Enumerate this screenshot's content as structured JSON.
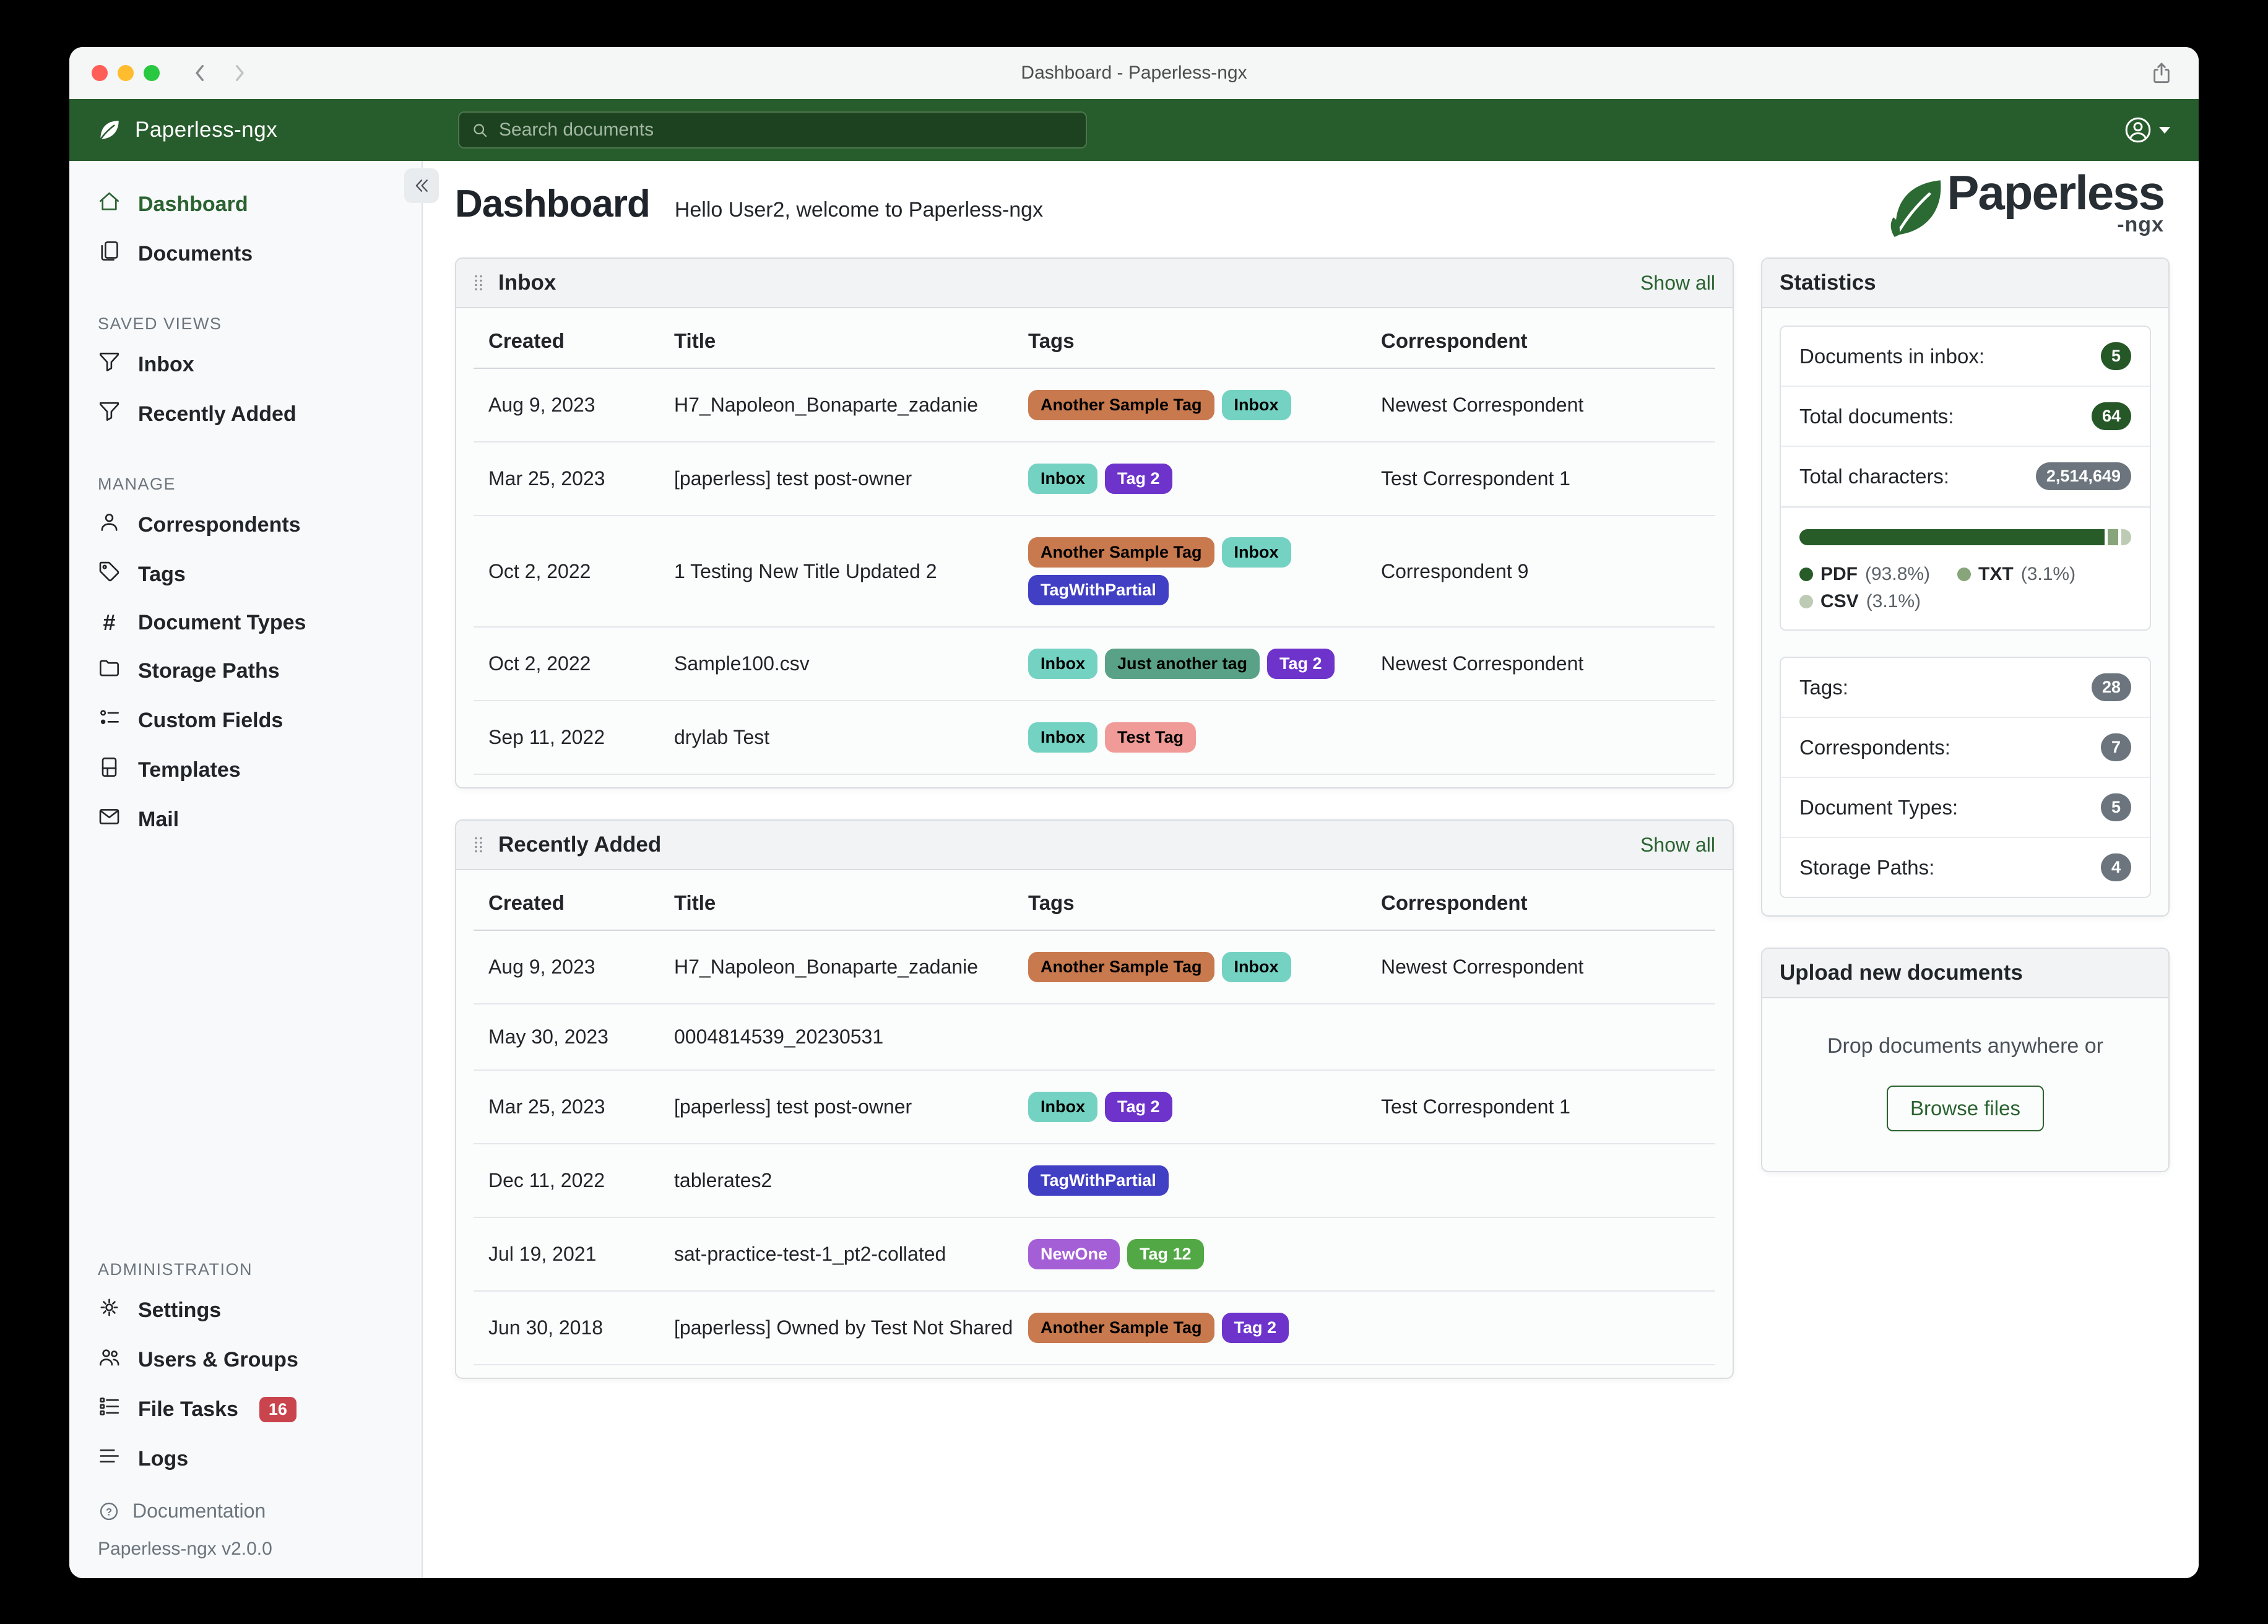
{
  "window": {
    "title": "Dashboard - Paperless-ngx"
  },
  "navbar": {
    "brand": "Paperless-ngx",
    "search_placeholder": "Search documents"
  },
  "colors": {
    "primary": "#2a6330",
    "navbar_green": "#275c2c",
    "badge_green": "#265827",
    "badge_gray": "#6c757d",
    "file_tasks_badge": "#c9444d",
    "traffic_red": "#ff5f57",
    "traffic_yellow": "#febc2e",
    "traffic_green": "#28c840"
  },
  "sidebar": {
    "sections": [
      {
        "header": null,
        "items": [
          {
            "label": "Dashboard",
            "icon": "house-icon",
            "active": true
          },
          {
            "label": "Documents",
            "icon": "documents-icon"
          }
        ]
      },
      {
        "header": "SAVED VIEWS",
        "items": [
          {
            "label": "Inbox",
            "icon": "funnel-icon"
          },
          {
            "label": "Recently Added",
            "icon": "funnel-icon"
          }
        ]
      },
      {
        "header": "MANAGE",
        "items": [
          {
            "label": "Correspondents",
            "icon": "person-icon"
          },
          {
            "label": "Tags",
            "icon": "tag-icon"
          },
          {
            "label": "Document Types",
            "icon": "hash-icon"
          },
          {
            "label": "Storage Paths",
            "icon": "folder-icon"
          },
          {
            "label": "Custom Fields",
            "icon": "custom-fields-icon"
          },
          {
            "label": "Templates",
            "icon": "template-icon"
          },
          {
            "label": "Mail",
            "icon": "mail-icon"
          }
        ]
      },
      {
        "header": "ADMINISTRATION",
        "push_down": true,
        "items": [
          {
            "label": "Settings",
            "icon": "gear-icon"
          },
          {
            "label": "Users & Groups",
            "icon": "users-icon"
          },
          {
            "label": "File Tasks",
            "icon": "tasks-icon",
            "badge": "16"
          },
          {
            "label": "Logs",
            "icon": "logs-icon"
          }
        ]
      }
    ],
    "footer": {
      "doc_label": "Documentation",
      "version": "Paperless-ngx v2.0.0"
    }
  },
  "main": {
    "heading": "Dashboard",
    "greeting": "Hello User2, welcome to Paperless-ngx",
    "logo_word": "Paperless",
    "logo_suffix": "-ngx"
  },
  "tag_colors": {
    "Another Sample Tag": {
      "bg": "#c8794e",
      "fg": "#000000"
    },
    "Inbox": {
      "bg": "#73d2c2",
      "fg": "#000000"
    },
    "Tag 2": {
      "bg": "#6d33cb",
      "fg": "#ffffff"
    },
    "TagWithPartial": {
      "bg": "#4140c5",
      "fg": "#ffffff"
    },
    "Just another tag": {
      "bg": "#5aa287",
      "fg": "#000000"
    },
    "Test Tag": {
      "bg": "#f09b97",
      "fg": "#000000"
    },
    "NewOne": {
      "bg": "#a55fd6",
      "fg": "#ffffff"
    },
    "Tag 12": {
      "bg": "#52a844",
      "fg": "#ffffff"
    }
  },
  "widgets": [
    {
      "title": "Inbox",
      "show_all": "Show all",
      "columns": [
        "Created",
        "Title",
        "Tags",
        "Correspondent"
      ],
      "rows": [
        {
          "created": "Aug 9, 2023",
          "title": "H7_Napoleon_Bonaparte_zadanie",
          "tags": [
            "Another Sample Tag",
            "Inbox"
          ],
          "correspondent": "Newest Correspondent"
        },
        {
          "created": "Mar 25, 2023",
          "title": "[paperless] test post-owner",
          "tags": [
            "Inbox",
            "Tag 2"
          ],
          "correspondent": "Test Correspondent 1"
        },
        {
          "created": "Oct 2, 2022",
          "title": "1 Testing New Title Updated 2",
          "tags": [
            "Another Sample Tag",
            "Inbox",
            "TagWithPartial"
          ],
          "correspondent": "Correspondent 9"
        },
        {
          "created": "Oct 2, 2022",
          "title": "Sample100.csv",
          "tags": [
            "Inbox",
            "Just another tag",
            "Tag 2"
          ],
          "correspondent": "Newest Correspondent"
        },
        {
          "created": "Sep 11, 2022",
          "title": "drylab Test",
          "tags": [
            "Inbox",
            "Test Tag"
          ],
          "correspondent": ""
        }
      ]
    },
    {
      "title": "Recently Added",
      "show_all": "Show all",
      "columns": [
        "Created",
        "Title",
        "Tags",
        "Correspondent"
      ],
      "rows": [
        {
          "created": "Aug 9, 2023",
          "title": "H7_Napoleon_Bonaparte_zadanie",
          "tags": [
            "Another Sample Tag",
            "Inbox"
          ],
          "correspondent": "Newest Correspondent"
        },
        {
          "created": "May 30, 2023",
          "title": "0004814539_20230531",
          "tags": [],
          "correspondent": ""
        },
        {
          "created": "Mar 25, 2023",
          "title": "[paperless] test post-owner",
          "tags": [
            "Inbox",
            "Tag 2"
          ],
          "correspondent": "Test Correspondent 1"
        },
        {
          "created": "Dec 11, 2022",
          "title": "tablerates2",
          "tags": [
            "TagWithPartial"
          ],
          "correspondent": ""
        },
        {
          "created": "Jul 19, 2021",
          "title": "sat-practice-test-1_pt2-collated",
          "tags": [
            "NewOne",
            "Tag 12"
          ],
          "correspondent": ""
        },
        {
          "created": "Jun 30, 2018",
          "title": "[paperless] Owned by Test Not Shared",
          "tags": [
            "Another Sample Tag",
            "Tag 2"
          ],
          "correspondent": ""
        }
      ]
    }
  ],
  "statistics": {
    "title": "Statistics",
    "counts_primary": [
      {
        "label": "Documents in inbox:",
        "value": "5",
        "style": "green"
      },
      {
        "label": "Total documents:",
        "value": "64",
        "style": "green"
      },
      {
        "label": "Total characters:",
        "value": "2,514,649",
        "style": "gray"
      }
    ],
    "file_types": {
      "segments": [
        {
          "name": "PDF",
          "pct": 93.8,
          "color": "#275c29"
        },
        {
          "name": "TXT",
          "pct": 3.1,
          "color": "#87a47a"
        },
        {
          "name": "CSV",
          "pct": 3.1,
          "color": "#bdcab4"
        }
      ]
    },
    "counts_secondary": [
      {
        "label": "Tags:",
        "value": "28",
        "style": "gray"
      },
      {
        "label": "Correspondents:",
        "value": "7",
        "style": "gray"
      },
      {
        "label": "Document Types:",
        "value": "5",
        "style": "gray"
      },
      {
        "label": "Storage Paths:",
        "value": "4",
        "style": "gray"
      }
    ]
  },
  "upload": {
    "title": "Upload new documents",
    "drop_text": "Drop documents anywhere or",
    "button": "Browse files"
  }
}
